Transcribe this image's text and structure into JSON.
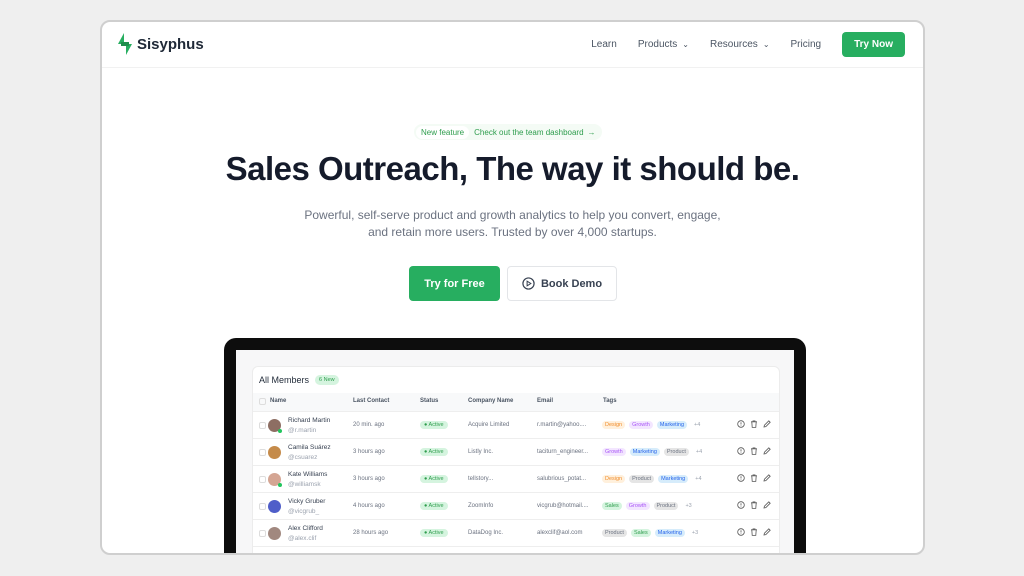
{
  "nav": {
    "brand": "Sisyphus",
    "links": [
      {
        "label": "Learn",
        "dropdown": false
      },
      {
        "label": "Products",
        "dropdown": true
      },
      {
        "label": "Resources",
        "dropdown": true
      },
      {
        "label": "Pricing",
        "dropdown": false
      }
    ],
    "cta": "Try Now"
  },
  "hero": {
    "badge_label": "New feature",
    "badge_link": "Check out the team dashboard",
    "title": "Sales Outreach, The way it should be.",
    "subtitle_line1": "Powerful, self-serve product and growth analytics to help you convert, engage,",
    "subtitle_line2": "and retain more users. Trusted by over 4,000 startups.",
    "primary_button": "Try for Free",
    "secondary_button": "Book Demo"
  },
  "colors": {
    "accent": "#27ae60"
  },
  "table": {
    "title": "All Members",
    "new_badge": "6 New",
    "columns": [
      "Name",
      "Last Contact",
      "Status",
      "Company Name",
      "Email",
      "Tags"
    ],
    "rows": [
      {
        "name": "Richard Martin",
        "handle": "@r.martin",
        "last": "20 min. ago",
        "status": "Active",
        "company": "Acquire Limited",
        "email": "r.martin@yahoo....",
        "tags": [
          "Design",
          "Growth",
          "Marketing"
        ],
        "more": "+4",
        "online": true
      },
      {
        "name": "Camila Suárez",
        "handle": "@csuarez",
        "last": "3 hours ago",
        "status": "Active",
        "company": "Listly Inc.",
        "email": "taciturn_engineer...",
        "tags": [
          "Growth",
          "Marketing",
          "Product"
        ],
        "more": "+4",
        "online": false
      },
      {
        "name": "Kate Williams",
        "handle": "@williamsk",
        "last": "3 hours ago",
        "status": "Active",
        "company": "tellstory...",
        "email": "salubrious_potat...",
        "tags": [
          "Design",
          "Product",
          "Marketing"
        ],
        "more": "+4",
        "online": true
      },
      {
        "name": "Vicky Gruber",
        "handle": "@vicgrub_",
        "last": "4 hours ago",
        "status": "Active",
        "company": "ZoomInfo",
        "email": "vicgrub@hotmail....",
        "tags": [
          "Sales",
          "Growth",
          "Product"
        ],
        "more": "+3",
        "online": false
      },
      {
        "name": "Alex Clifford",
        "handle": "@alex.clif",
        "last": "28 hours ago",
        "status": "Active",
        "company": "DataDog Inc.",
        "email": "alexclif@aol.com",
        "tags": [
          "Product",
          "Sales",
          "Marketing"
        ],
        "more": "+3",
        "online": false
      }
    ]
  }
}
